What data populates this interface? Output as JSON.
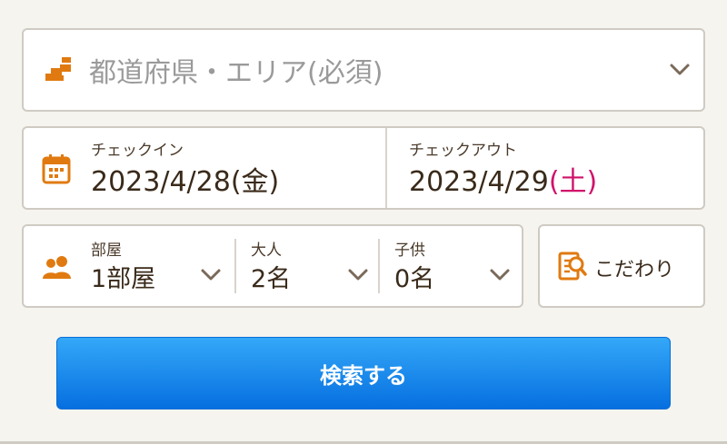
{
  "area": {
    "placeholder": "都道府県・エリア(必須)"
  },
  "checkin": {
    "label": "チェックイン",
    "date": "2023/4/28",
    "weekday": "(金)"
  },
  "checkout": {
    "label": "チェックアウト",
    "date": "2023/4/29",
    "weekday": "(土)"
  },
  "rooms": {
    "label": "部屋",
    "value": "1部屋"
  },
  "adults": {
    "label": "大人",
    "value": "2名"
  },
  "children": {
    "label": "子供",
    "value": "0名"
  },
  "kodawari": {
    "label": "こだわり"
  },
  "search": {
    "label": "検索する"
  },
  "colors": {
    "accent": "#e07a10",
    "saturday": "#d0126b",
    "button_top": "#34a8f8",
    "button_bottom": "#066fe0"
  },
  "icons": [
    "map-icon",
    "calendar-icon",
    "people-icon",
    "chevron-down-icon",
    "filter-document-icon"
  ]
}
